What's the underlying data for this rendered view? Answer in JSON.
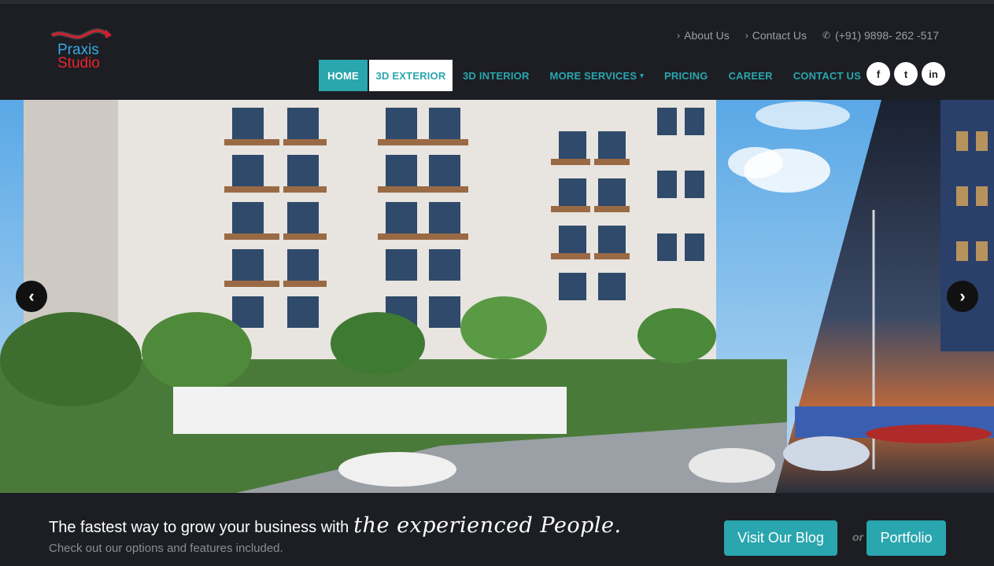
{
  "logo": {
    "line1": "Praxis",
    "line2": "Studio"
  },
  "topbar": {
    "about": "About Us",
    "contact": "Contact Us",
    "phone": "(+91) 9898- 262 -517"
  },
  "nav": {
    "home": "HOME",
    "exterior": "3D EXTERIOR",
    "interior": "3D INTERIOR",
    "more": "MORE SERVICES",
    "pricing": "PRICING",
    "career": "CAREER",
    "contact": "CONTACT US"
  },
  "social": {
    "facebook": "f",
    "twitter": "t",
    "linkedin": "in"
  },
  "hero": {
    "prev": "‹",
    "next": "›"
  },
  "cta": {
    "title_plain": "The fastest way to grow your business with",
    "title_script": "the experienced People.",
    "subtitle": "Check out our options and features included.",
    "blog_button": "Visit Our Blog",
    "or": "or",
    "portfolio_button": "Portfolio"
  },
  "colors": {
    "accent": "#2aa6ae",
    "header_bg": "#1c1e23"
  }
}
